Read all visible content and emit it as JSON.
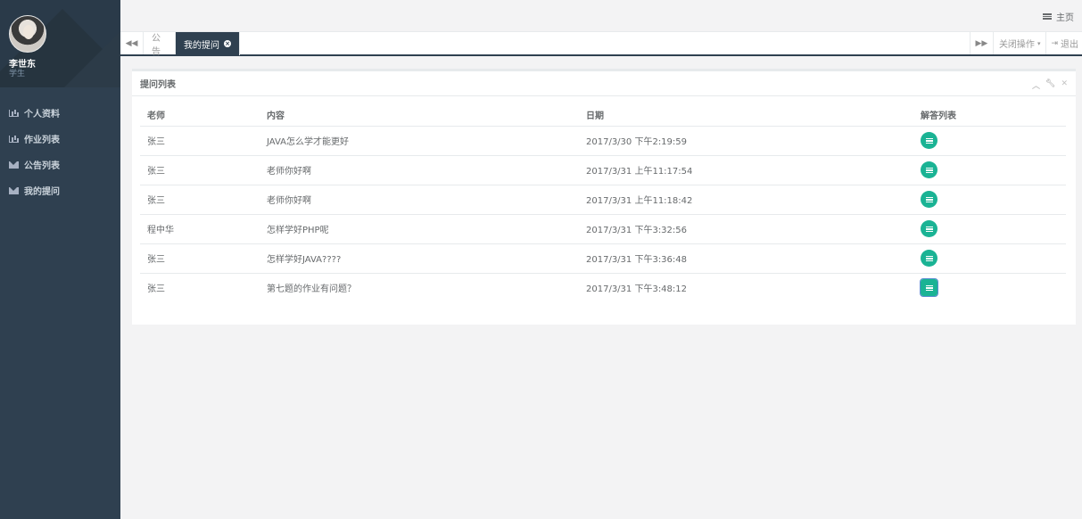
{
  "sidebar": {
    "user_name": "李世东",
    "user_role": "学生",
    "items": [
      {
        "label": "个人资料",
        "icon": "chart-icon"
      },
      {
        "label": "作业列表",
        "icon": "chart-icon"
      },
      {
        "label": "公告列表",
        "icon": "envelope-icon"
      },
      {
        "label": "我的提问",
        "icon": "envelope-icon"
      }
    ]
  },
  "topbar": {
    "home_label": "主页"
  },
  "tabs": {
    "items": [
      {
        "label": "公告",
        "active": false
      },
      {
        "label": "我的提问",
        "active": true
      }
    ],
    "close_ops_label": "关闭操作",
    "logout_label": "退出"
  },
  "panel": {
    "title": "提问列表",
    "columns": [
      "老师",
      "内容",
      "日期",
      "解答列表"
    ],
    "rows": [
      {
        "teacher": "张三",
        "content": "JAVA怎么学才能更好",
        "date": "2017/3/30 下午2:19:59"
      },
      {
        "teacher": "张三",
        "content": "老师你好啊",
        "date": "2017/3/31 上午11:17:54"
      },
      {
        "teacher": "张三",
        "content": "老师你好啊",
        "date": "2017/3/31 上午11:18:42"
      },
      {
        "teacher": "程中华",
        "content": "怎样学好PHP呢",
        "date": "2017/3/31 下午3:32:56"
      },
      {
        "teacher": "张三",
        "content": "怎样学好JAVA????",
        "date": "2017/3/31 下午3:36:48"
      },
      {
        "teacher": "张三",
        "content": "第七题的作业有问题？",
        "date": "2017/3/31 下午3:48:12"
      }
    ]
  },
  "colors": {
    "sidebar_bg": "#2f4050",
    "accent_green": "#1ab394",
    "page_bg": "#f3f3f4"
  }
}
